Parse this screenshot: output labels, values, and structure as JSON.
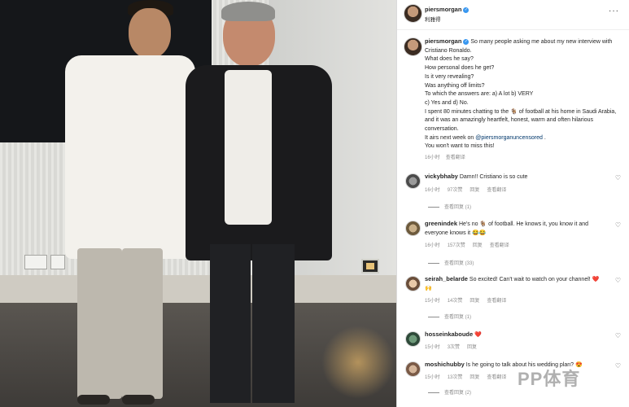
{
  "post": {
    "username": "piersmorgan",
    "subtitle": "利雅得",
    "more_label": "···",
    "caption_lines": [
      "So many people asking me about my new interview with Cristiano Ronaldo.",
      "What does he say?",
      "How personal does he get?",
      "Is it very revealing?",
      "Was anything off limits?",
      "To which the answers are: a) A lot b) VERY",
      "c) Yes and d) No.",
      "I spent 80 minutes chatting to the 🐐 of football at his home in Saudi Arabia, and it was an amazingly heartfelt, honest, warm and often hilarious conversation.",
      "It airs next week on",
      "You won't want to miss this!"
    ],
    "caption_link": "@piersmorganuncensored",
    "caption_link_suffix": ".",
    "time": "16小时",
    "translate": "查看翻译"
  },
  "comments": [
    {
      "user": "vickybhaby",
      "text": "Damn!! Cristiano is so cute",
      "time": "16小时",
      "likes": "97次赞",
      "reply": "回复",
      "translate": "查看翻译",
      "view_replies": "查看回复 (1)"
    },
    {
      "user": "greenindek",
      "text": "He's no 🐐 of football. He knows it, you know it and everyone knows it 😂😂",
      "time": "16小时",
      "likes": "157次赞",
      "reply": "回复",
      "translate": "查看翻译",
      "view_replies": "查看回复 (33)"
    },
    {
      "user": "seirah_belarde",
      "text": "So excited! Can't wait to watch on your channel! ❤️🙌",
      "time": "15小时",
      "likes": "14次赞",
      "reply": "回复",
      "translate": "查看翻译",
      "view_replies": "查看回复 (1)"
    },
    {
      "user": "hosseinkaboude",
      "text": "❤️",
      "time": "15小时",
      "likes": "3次赞",
      "reply": "回复"
    },
    {
      "user": "moshichubby",
      "text": "Is he going to talk about his wedding plan? 😍",
      "time": "15小时",
      "likes": "13次赞",
      "reply": "回复",
      "translate": "查看翻译",
      "view_replies": "查看回复 (2)"
    }
  ],
  "watermark": "PP体育",
  "colors": {
    "link": "#00376b",
    "verified": "#3897f0",
    "muted": "#8e8e8e",
    "heart": "#e0245e"
  }
}
